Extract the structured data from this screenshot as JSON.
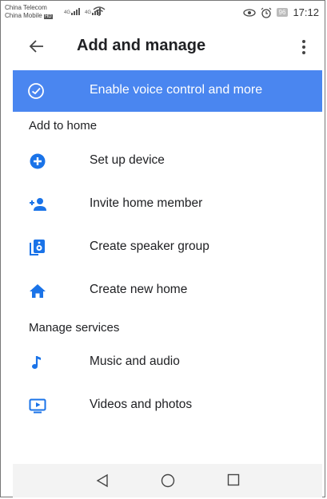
{
  "status_bar": {
    "carrier_1": "China Telecom",
    "carrier_2": "China Mobile",
    "sim_badge": "HD",
    "net_1": "4G",
    "net_2": "4G",
    "battery": "96",
    "time": "17:12"
  },
  "app_bar": {
    "title": "Add and manage",
    "back_icon": "arrow-left-icon",
    "menu_icon": "more-vert-icon"
  },
  "banner": {
    "label": "Enable voice control and more",
    "icon": "check-circle-icon"
  },
  "sections": [
    {
      "title": "Add to home",
      "items": [
        {
          "label": "Set up device",
          "icon": "add-circle-icon"
        },
        {
          "label": "Invite home member",
          "icon": "person-add-icon"
        },
        {
          "label": "Create speaker group",
          "icon": "speaker-icon"
        },
        {
          "label": "Create new home",
          "icon": "home-icon"
        }
      ]
    },
    {
      "title": "Manage services",
      "items": [
        {
          "label": "Music and audio",
          "icon": "music-note-icon"
        },
        {
          "label": "Videos and photos",
          "icon": "video-play-icon"
        }
      ]
    }
  ],
  "nav_bar": {
    "back": "triangle-back-icon",
    "home": "circle-home-icon",
    "recents": "square-recents-icon"
  },
  "colors": {
    "accent": "#4a86f0",
    "icon_blue": "#1a73e8"
  }
}
